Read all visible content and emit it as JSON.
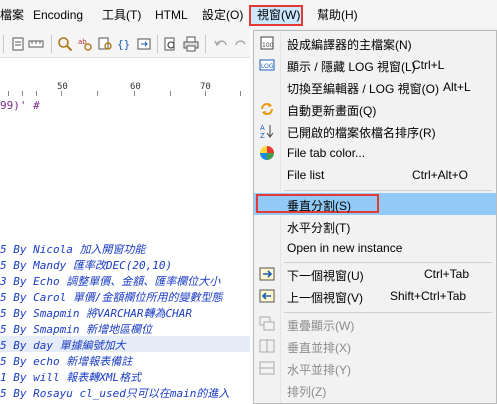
{
  "menubar": {
    "items": [
      {
        "id": "file",
        "label": "檔案"
      },
      {
        "id": "encoding",
        "label": "Encoding"
      },
      {
        "id": "tools",
        "label": "工具(T)"
      },
      {
        "id": "html",
        "label": "HTML"
      },
      {
        "id": "settings",
        "label": "設定(O)"
      },
      {
        "id": "window",
        "label": "視窗(W)"
      },
      {
        "id": "help",
        "label": "幫助(H)"
      }
    ]
  },
  "ruler": {
    "marks": [
      "50",
      "60",
      "70"
    ]
  },
  "editor": {
    "lines": [
      {
        "text": "99)'     #"
      },
      {
        "text": "5 By Nicola 加入開窗功能"
      },
      {
        "text": "5 By Mandy 匯率改DEC(20,10)"
      },
      {
        "text": "3 By Echo 調整單價、金額、匯率欄位大小"
      },
      {
        "text": "5 By Carol 單價/金額欄位所用的變數型態"
      },
      {
        "text": "5 By Smapmin 將VARCHAR轉為CHAR"
      },
      {
        "text": "5 By Smapmin 新增地區欄位"
      },
      {
        "text": "5 By day  單據編號加大"
      },
      {
        "text": "5 By echo 新增報表備註"
      },
      {
        "text": "1 By will 報表轉XML格式"
      },
      {
        "text": "5 By Rosayu cl_used只可以在main的進入"
      }
    ]
  },
  "window_menu": {
    "items": [
      {
        "label": "設成編譯器的主檔案(N)",
        "shortcut": "",
        "icon": "main-file-icon"
      },
      {
        "label": "顯示 / 隱藏 LOG 視窗(L)",
        "shortcut": "Ctrl+L",
        "icon": "log-window-icon"
      },
      {
        "label": "切換至編輯器 / LOG 視窗(O)",
        "shortcut": "Alt+L",
        "icon": ""
      },
      {
        "label": "自動更新畫面(Q)",
        "shortcut": "",
        "icon": "auto-refresh-icon"
      },
      {
        "label": "已開啟的檔案依檔名排序(R)",
        "shortcut": "",
        "icon": "sort-az-icon"
      },
      {
        "label": "File tab color...",
        "shortcut": "",
        "icon": "color-wheel-icon"
      },
      {
        "label": "File list",
        "shortcut": "Ctrl+Alt+O",
        "icon": ""
      },
      {
        "label": "垂直分割(S)",
        "shortcut": "",
        "icon": ""
      },
      {
        "label": "水平分割(T)",
        "shortcut": "",
        "icon": ""
      },
      {
        "label": "Open in new instance",
        "shortcut": "",
        "icon": ""
      },
      {
        "label": "下一個視窗(U)",
        "shortcut": "Ctrl+Tab",
        "icon": "next-window-icon"
      },
      {
        "label": "上一個視窗(V)",
        "shortcut": "Shift+Ctrl+Tab",
        "icon": "prev-window-icon"
      },
      {
        "label": "重疊顯示(W)",
        "shortcut": "",
        "icon": "cascade-icon"
      },
      {
        "label": "垂直並排(X)",
        "shortcut": "",
        "icon": "tile-vertical-icon"
      },
      {
        "label": "水平並排(Y)",
        "shortcut": "",
        "icon": "tile-horizontal-icon"
      },
      {
        "label": "排列(Z)",
        "shortcut": "",
        "icon": ""
      }
    ]
  },
  "colors": {
    "accent_highlight": "#91c9f7",
    "annotation_red": "#e53935",
    "comment_blue": "#1a3cc4"
  }
}
